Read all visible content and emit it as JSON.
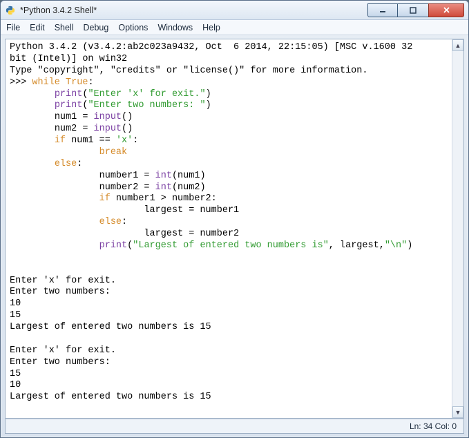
{
  "window": {
    "title": "*Python 3.4.2 Shell*"
  },
  "menu": {
    "file": "File",
    "edit": "Edit",
    "shell": "Shell",
    "debug": "Debug",
    "options": "Options",
    "windows": "Windows",
    "help": "Help"
  },
  "banner": {
    "line1": "Python 3.4.2 (v3.4.2:ab2c023a9432, Oct  6 2014, 22:15:05) [MSC v.1600 32",
    "line2": "bit (Intel)] on win32",
    "line3": "Type \"copyright\", \"credits\" or \"license()\" for more information."
  },
  "prompt": ">>> ",
  "code": {
    "kw_while": "while",
    "kw_true": "True",
    "colon": ":",
    "fn_print": "print",
    "fn_input": "input",
    "fn_int": "int",
    "kw_if": "if",
    "kw_else": "else",
    "kw_break": "break",
    "str_exit": "\"Enter 'x' for exit.\"",
    "str_two": "\"Enter two numbers: \"",
    "assign_num1": "num1 = ",
    "assign_num2": "num2 = ",
    "empty_call": "()",
    "cond1": " num1 == ",
    "lit_x": "'x'",
    "n1_assign": "number1 = ",
    "n2_assign": "number2 = ",
    "int_num1": "(num1)",
    "int_num2": "(num2)",
    "cond2": " number1 > number2:",
    "largest1": "largest = number1",
    "largest2": "largest = number2",
    "str_largest": "\"Largest of entered two numbers is\"",
    "print_tail": ", largest,",
    "str_nl": "\"\\n\"",
    "close_paren": ")",
    "open_paren": "("
  },
  "output": {
    "blank": "",
    "exit1": "Enter 'x' for exit.",
    "two1": "Enter two numbers:",
    "v10": "10",
    "v15": "15",
    "res1": "Largest of entered two numbers is 15",
    "exit2": "Enter 'x' for exit.",
    "two2": "Enter two numbers:",
    "v15b": "15",
    "v10b": "10",
    "res2": "Largest of entered two numbers is 15"
  },
  "status": {
    "pos": "Ln: 34 Col: 0"
  }
}
